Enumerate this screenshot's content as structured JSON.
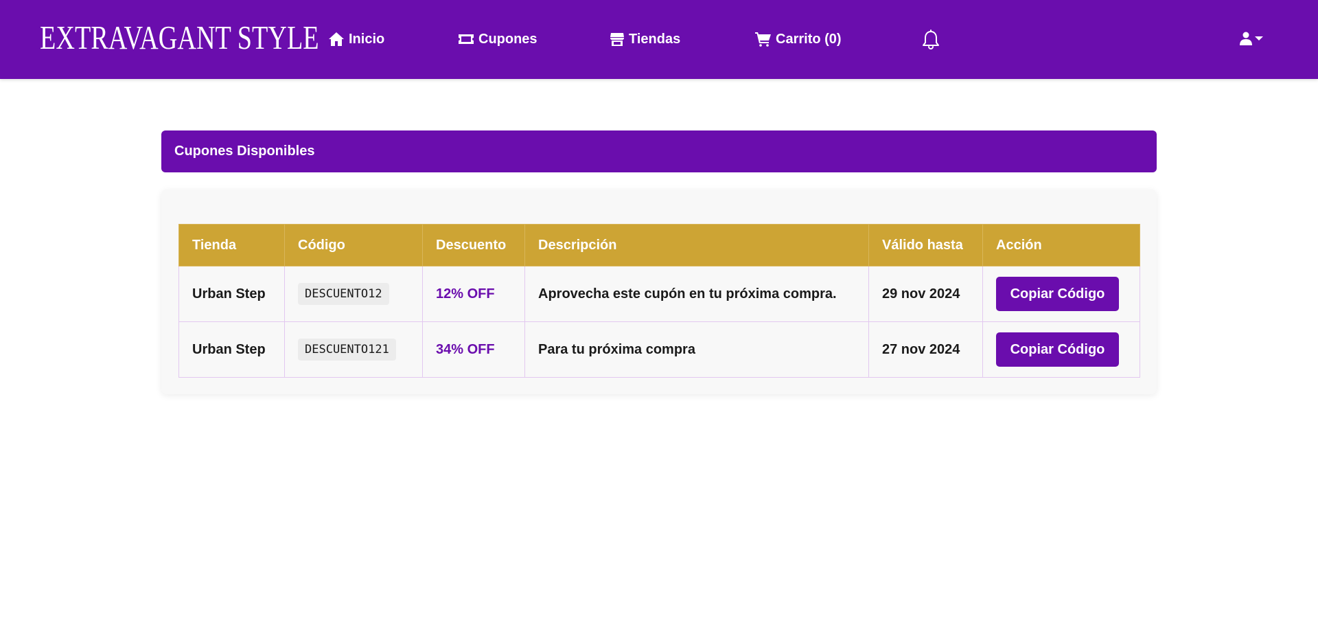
{
  "brand": {
    "logo_text": "EXTRAVAGANT STYLE"
  },
  "nav": {
    "inicio": "Inicio",
    "cupones": "Cupones",
    "tiendas": "Tiendas",
    "carrito": "Carrito (0)"
  },
  "icons": {
    "home": "home-icon",
    "ticket": "ticket-icon",
    "store": "store-icon",
    "cart": "cart-icon",
    "bell": "bell-icon",
    "user": "user-icon",
    "caret": "caret-down-icon"
  },
  "colors": {
    "primary": "#6a0dad",
    "table_header": "#cda434",
    "code_bg": "#ececec"
  },
  "section": {
    "title": "Cupones Disponibles"
  },
  "table": {
    "headers": [
      "Tienda",
      "Código",
      "Descuento",
      "Descripción",
      "Válido hasta",
      "Acción"
    ],
    "rows": [
      {
        "tienda": "Urban Step",
        "codigo": "DESCUENTO12",
        "descuento": "12% OFF",
        "descripcion": "Aprovecha este cupón en tu próxima compra.",
        "valido_hasta": "29 nov 2024",
        "accion": "Copiar Código"
      },
      {
        "tienda": "Urban Step",
        "codigo": "DESCUENTO121",
        "descuento": "34% OFF",
        "descripcion": "Para tu próxima compra",
        "valido_hasta": "27 nov 2024",
        "accion": "Copiar Código"
      }
    ]
  }
}
